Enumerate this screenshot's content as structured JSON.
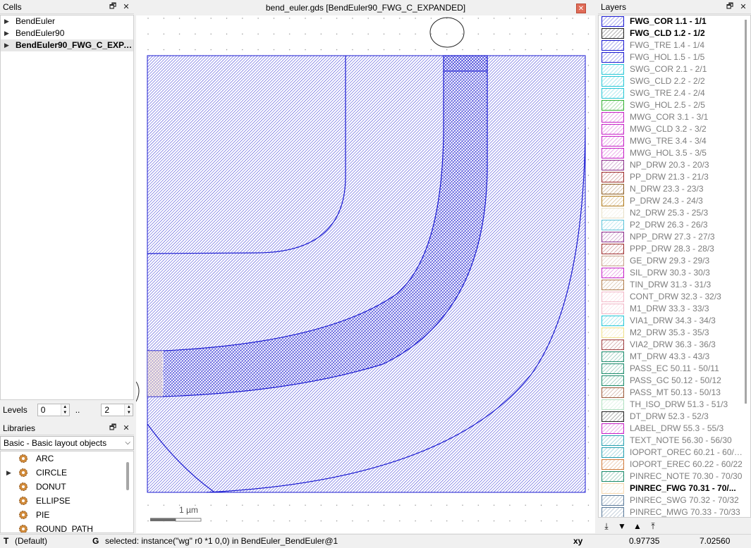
{
  "cells": {
    "title": "Cells",
    "items": [
      {
        "label": "BendEuler"
      },
      {
        "label": "BendEuler90"
      },
      {
        "label": "BendEuler90_FWG_C_EXPA..."
      }
    ]
  },
  "levels": {
    "label": "Levels",
    "from": "0",
    "sep": "..",
    "to": "2"
  },
  "libraries": {
    "title": "Libraries",
    "selected": "Basic - Basic layout objects",
    "items": [
      {
        "label": "ARC"
      },
      {
        "label": "CIRCLE"
      },
      {
        "label": "DONUT"
      },
      {
        "label": "ELLIPSE"
      },
      {
        "label": "PIE"
      },
      {
        "label": "ROUND_PATH"
      }
    ]
  },
  "canvas": {
    "title": "bend_euler.gds [BendEuler90_FWG_C_EXPANDED]",
    "scale_label": "1  µm"
  },
  "layers": {
    "title": "Layers",
    "items": [
      {
        "label": "FWG_COR 1.1 - 1/1",
        "color": "#1a1ad1"
      },
      {
        "label": "FWG_CLD 1.2 - 1/2",
        "color": "#222222"
      },
      {
        "label": "FWG_TRE 1.4 - 1/4",
        "color": "#1a1ad1"
      },
      {
        "label": "FWG_HOL 1.5 - 1/5",
        "color": "#1a1ad1"
      },
      {
        "label": "SWG_COR 2.1 - 2/1",
        "color": "#27c7d6"
      },
      {
        "label": "SWG_CLD 2.2 - 2/2",
        "color": "#27c7d6"
      },
      {
        "label": "SWG_TRE 2.4 - 2/4",
        "color": "#27c7d6"
      },
      {
        "label": "SWG_HOL 2.5 - 2/5",
        "color": "#33b033"
      },
      {
        "label": "MWG_COR 3.1 - 3/1",
        "color": "#c61fc6"
      },
      {
        "label": "MWG_CLD 3.2 - 3/2",
        "color": "#c61fc6"
      },
      {
        "label": "MWG_TRE 3.4 - 3/4",
        "color": "#c61fc6"
      },
      {
        "label": "MWG_HOL 3.5 - 3/5",
        "color": "#c61fc6"
      },
      {
        "label": "NP_DRW 20.3 - 20/3",
        "color": "#8a2c8a"
      },
      {
        "label": "PP_DRW 21.3 - 21/3",
        "color": "#9c2a2a"
      },
      {
        "label": "N_DRW 23.3 - 23/3",
        "color": "#8b5a1e"
      },
      {
        "label": "P_DRW 24.3 - 24/3",
        "color": "#b07a1a"
      },
      {
        "label": "N2_DRW 25.3 - 25/3",
        "color": "#e8e0c8"
      },
      {
        "label": "P2_DRW 26.3 - 26/3",
        "color": "#5bc2d8"
      },
      {
        "label": "NPP_DRW 27.3 - 27/3",
        "color": "#8a2c8a"
      },
      {
        "label": "PPP_DRW 28.3 - 28/3",
        "color": "#9c2a2a"
      },
      {
        "label": "GE_DRW 29.3 - 29/3",
        "color": "#c7a08a"
      },
      {
        "label": "SIL_DRW 30.3 - 30/3",
        "color": "#c61fc6"
      },
      {
        "label": "TIN_DRW 31.3 - 31/3",
        "color": "#b07a4a"
      },
      {
        "label": "CONT_DRW 32.3 - 32/3",
        "color": "#f2b8c8"
      },
      {
        "label": "M1_DRW 33.3 - 33/3",
        "color": "#f2b8c8"
      },
      {
        "label": "VIA1_DRW 34.3 - 34/3",
        "color": "#27c7d6"
      },
      {
        "label": "M2_DRW 35.3 - 35/3",
        "color": "#f0e08a"
      },
      {
        "label": "VIA2_DRW 36.3 - 36/3",
        "color": "#9c3a3a"
      },
      {
        "label": "MT_DRW 43.3 - 43/3",
        "color": "#1a8a6a"
      },
      {
        "label": "PASS_EC 50.11 - 50/11",
        "color": "#1a8a6a"
      },
      {
        "label": "PASS_GC 50.12 - 50/12",
        "color": "#1a8a6a"
      },
      {
        "label": "PASS_MT 50.13 - 50/13",
        "color": "#9c5a3a"
      },
      {
        "label": "TH_ISO_DRW 51.3 - 51/3",
        "color": "#b0e0c0"
      },
      {
        "label": "DT_DRW 52.3 - 52/3",
        "color": "#222222"
      },
      {
        "label": "LABEL_DRW 55.3 - 55/3",
        "color": "#c61fc6"
      },
      {
        "label": "TEXT_NOTE 56.30 - 56/30",
        "color": "#27a0b0"
      },
      {
        "label": "IOPORT_OREC 60.21 - 60/21",
        "color": "#27a0b0"
      },
      {
        "label": "IOPORT_EREC 60.22 - 60/22",
        "color": "#d07a3a"
      },
      {
        "label": "PINREC_NOTE 70.30 - 70/30",
        "color": "#1a8a6a"
      },
      {
        "label": "PINREC_FWG 70.31 - 70/...",
        "color": "#f5d8b0"
      },
      {
        "label": "PINREC_SWG 70.32 - 70/32",
        "color": "#5a7a9a"
      },
      {
        "label": "PINREC_MWG 70.33 - 70/33",
        "color": "#5a7a9a"
      }
    ]
  },
  "status": {
    "mode": "T",
    "mode_label": "(Default)",
    "grid": "G",
    "message": "selected: instance(\"wg\" r0 *1 0,0) in BendEuler_BendEuler@1",
    "coord_label": "xy",
    "x": "0.97735",
    "y": "7.02560"
  },
  "colors": {
    "shape_blue": "#1a1ad1",
    "background": "#ffffff"
  }
}
